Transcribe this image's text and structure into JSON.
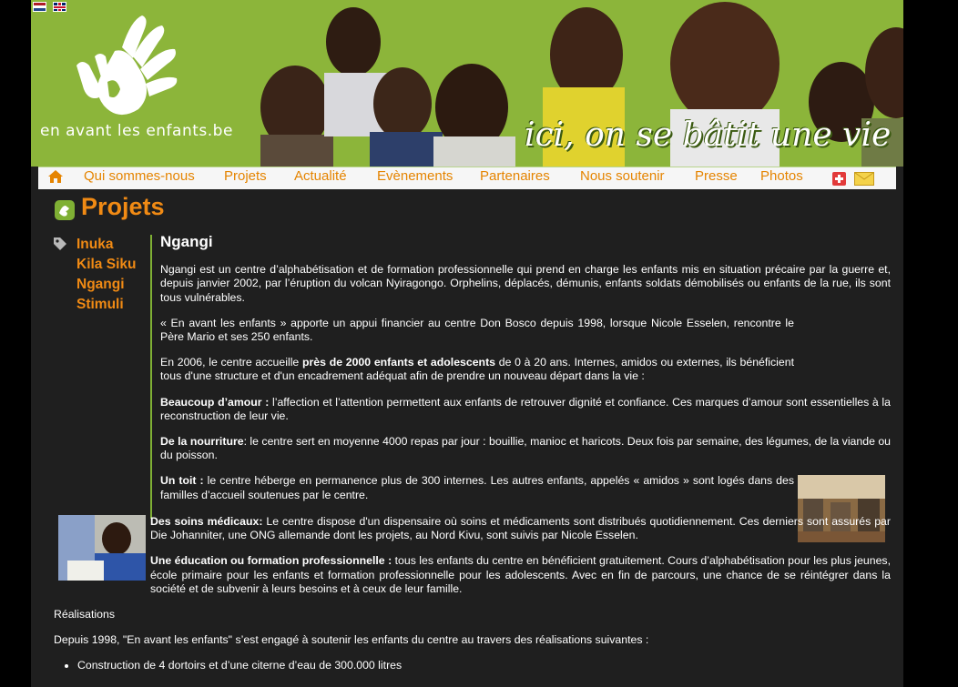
{
  "header": {
    "logo_text": "en avant les enfants.be",
    "tagline": "ici, on se bâtit une vie",
    "languages": [
      "NL",
      "EN"
    ]
  },
  "nav": {
    "items": [
      "Qui sommes-nous",
      "Projets",
      "Actualité",
      "Evènements",
      "Partenaires",
      "Nous soutenir",
      "Presse",
      "Photos"
    ],
    "icons": [
      "home-icon",
      "plus-icon",
      "mail-icon"
    ]
  },
  "page": {
    "title": "Projets"
  },
  "subnav": {
    "items": [
      "Inuka",
      "Kila Siku",
      "Ngangi",
      "Stimuli"
    ]
  },
  "article": {
    "title": "Ngangi",
    "p1": "Ngangi est un centre d’alphabétisation et de formation professionnelle qui prend en charge les enfants mis en situation précaire par la guerre et, depuis janvier 2002, par l’éruption du volcan Nyiragongo. Orphelins, déplacés, démunis, enfants soldats démobilisés ou enfants de la rue, ils sont tous vulnérables.",
    "p2": "« En avant les enfants » apporte un appui financier au centre Don Bosco depuis 1998, lorsque Nicole Esselen, rencontre le Père Mario et ses 250 enfants.",
    "p3_a": "En 2006, le centre accueille ",
    "p3_b": "près de 2000 enfants et adolescents",
    "p3_c": " de 0 à 20 ans. Internes, amidos ou externes, ils bénéficient tous d'une structure et d'un encadrement adéquat afin de prendre un nouveau départ dans la vie :",
    "love_label": "Beaucoup d’amour :",
    "love_text": " l’affection et l’attention permettent aux enfants de retrouver dignité et confiance. Ces marques d’amour sont essentielles à la reconstruction de leur vie.",
    "food_label": "De la nourriture",
    "food_text": ": le centre sert en moyenne 4000 repas par jour : bouillie, manioc et haricots. Deux fois par semaine, des légumes, de la viande ou du poisson.",
    "roof_label": "Un toit :",
    "roof_text": " le centre héberge en permanence plus de 300 internes. Les autres enfants, appelés « amidos » sont logés dans des familles d’accueil soutenues par le centre.",
    "care_label": "Des soins médicaux:",
    "care_text": " Le centre dispose d'un dispensaire où soins et médicaments sont distribués quotidiennement. Ces derniers sont assurés par Die Johanniter, une ONG allemande dont les projets, au Nord Kivu, sont suivis par Nicole Esselen.",
    "edu_label": "Une éducation ou formation professionnelle :",
    "edu_text": " tous les enfants du centre en bénéficient gratuitement. Cours d’alphabétisation pour les plus jeunes, école primaire pour les enfants et formation professionnelle pour les adolescents. Avec en fin de parcours, une chance de se réintégrer dans la société et de subvenir à leurs besoins et à ceux de leur famille.",
    "achievements_title": "Réalisations",
    "achievements_intro": "Depuis 1998, \"En avant les enfants\" s’est engagé à soutenir les enfants du centre au travers des réalisations suivantes :",
    "list": [
      "Construction de 4 dortoirs et d’une citerne d’eau de 300.000 litres"
    ]
  },
  "colors": {
    "header_green": "#8cb53a",
    "accent_orange": "#f08a14",
    "nav_orange": "#e58400",
    "content_bg": "#1f1f1f"
  }
}
